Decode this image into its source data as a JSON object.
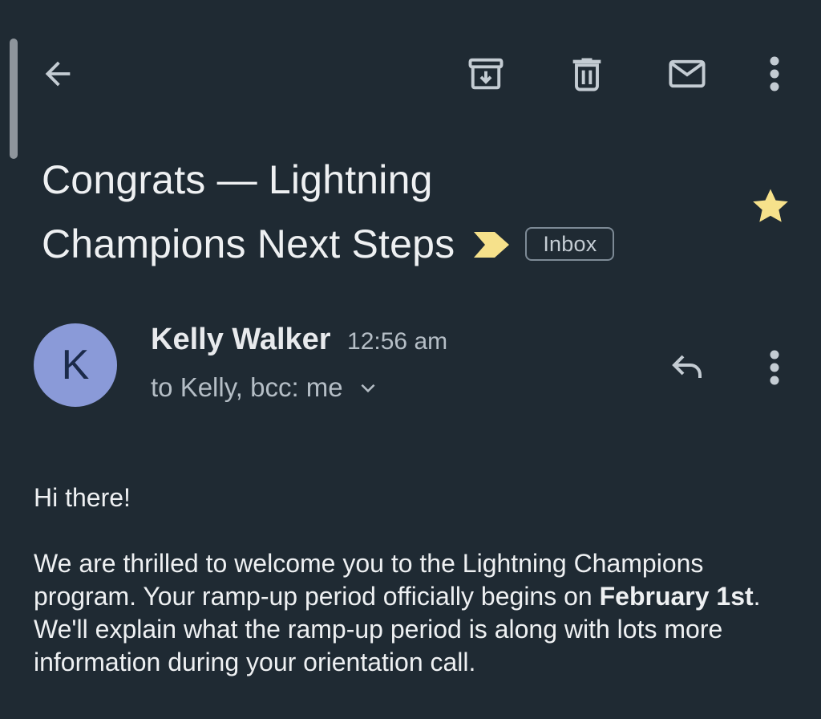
{
  "toolbar": {
    "back_icon": "arrow-left-icon",
    "archive_icon": "archive-icon",
    "delete_icon": "trash-icon",
    "mark_unread_icon": "mail-icon",
    "more_icon": "more-vert-icon"
  },
  "subject": {
    "line1": "Congrats — Lightning",
    "line2": "Champions Next Steps",
    "importance_color": "#f6e18b",
    "label": "Inbox",
    "starred": true,
    "star_color": "#f6e18b"
  },
  "sender": {
    "avatar_letter": "K",
    "avatar_color": "#8a9ad8",
    "name": "Kelly Walker",
    "time": "12:56 am",
    "recipients": "to Kelly, bcc: me",
    "reply_icon": "reply-icon",
    "more_icon": "more-vert-icon"
  },
  "body": {
    "greeting": "Hi there!",
    "p1_part1": "We are thrilled to welcome you to the Lightning Champions program. Your ramp-up period officially begins on ",
    "p1_bold": "February 1st",
    "p1_part2": ". We'll explain what the ramp-up period is along with lots more information during your orientation call."
  },
  "colors": {
    "background": "#1f2a33",
    "icon": "#c4ccd3"
  }
}
